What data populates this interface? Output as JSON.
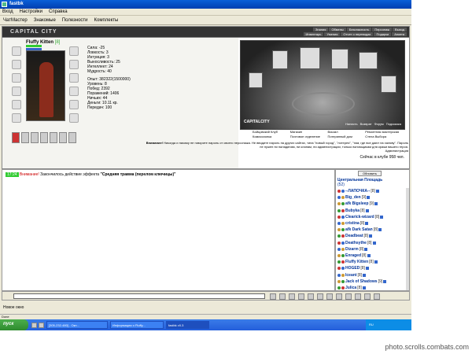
{
  "window": {
    "title": "fastbk"
  },
  "menubar": {
    "items": [
      "Вход",
      "Настройки",
      "Справка"
    ]
  },
  "toolbar": {
    "items": [
      "ЧатМастер",
      "Знакомые",
      "Полезности",
      "Комплекты"
    ]
  },
  "game": {
    "logo": "CAPITAL CITY",
    "nav_top": [
      "Знания",
      "Обмены",
      "Безопасность",
      "Персонаж",
      "Выход"
    ],
    "nav_bottom": [
      "Инвентарь",
      "Умения",
      "Отчет о переводах",
      "Подарки",
      "Анкета"
    ]
  },
  "character": {
    "name": "Fluffy Kitten",
    "level": "[8]",
    "stats": [
      "Сила: -25",
      "Ловкость: 3",
      "Интуиция: 3",
      "Выносливость: 25",
      "Интеллект: 24",
      "Мудрость: 40"
    ],
    "info": [
      "Опыт: 382322(1500000)",
      "Уровень: 8",
      "Побед: 2392",
      "Поражений: 1406",
      "Ничьих: 44",
      "Деньги: 10.11 кр.",
      "Передач: 100"
    ]
  },
  "city": {
    "logo": "CAPITALCITY",
    "menu": [
      "Напасть",
      "Возврат",
      "Форум",
      "Подсказка"
    ],
    "links": [
      "Бойцовский Клуб",
      "Магазин",
      "Вокзал",
      "Ремонтная мастерская",
      "Комиссионка",
      "Почтовое отделение",
      "Потерянный дом",
      "Стела Выбора"
    ]
  },
  "warning": {
    "prefix": "Внимание!",
    "text": "Никогда и никому не говорите пароль от своего персонажа. Не вводите пароль на других сайтах, типа \"новый город\", \"лотерея\", \"там, где все дают на халяву\". Пароль не нужен ни паладинам, ни кланам, ни администрации, только взломщикам для кражи вашего героя.",
    "signature": "Администрация",
    "online": "Сейчас в клубе 958 чел."
  },
  "chat": {
    "tag": "17:24",
    "attention": "Внимание!",
    "message": "Закончилось действие эффекта",
    "effect": "\"Средняя травма (перелом ключицы)\""
  },
  "roster": {
    "refresh": "Обновить",
    "title": "Центральная Площадь",
    "count": "(52)",
    "players": [
      {
        "name": "--ЛАПОЧКА--",
        "level": "[8]"
      },
      {
        "name": "Big_den",
        "level": "[9]"
      },
      {
        "name": "afk Bigsleep",
        "level": "[9]"
      },
      {
        "name": "Bubyka",
        "level": "[8]"
      },
      {
        "name": "Clearick-wizard",
        "level": "[8]"
      },
      {
        "name": "cristina",
        "level": "[8]"
      },
      {
        "name": "afk Dark Satan",
        "level": "[8]"
      },
      {
        "name": "Deadbeat",
        "level": "[8]"
      },
      {
        "name": "Deathsythe",
        "level": "[8]"
      },
      {
        "name": "Dizarm",
        "level": "[8]"
      },
      {
        "name": "Enraged",
        "level": "[8]"
      },
      {
        "name": "Fluffy Kitten",
        "level": "[8]"
      },
      {
        "name": "HOGED",
        "level": "[8]"
      },
      {
        "name": "Iceant",
        "level": "[8]"
      },
      {
        "name": "Jack of Shadows",
        "level": "[9]"
      },
      {
        "name": "Julica",
        "level": "[8]"
      },
      {
        "name": "afk Motion Mouse",
        "level": "[1"
      }
    ]
  },
  "bottom": {
    "new_window": "Новое окно",
    "status": "Done"
  },
  "taskbar": {
    "start": "пуск",
    "tasks": [
      "[305-232-480] - Окн...",
      "Информация о Fluffy...",
      "fastbk v0.3"
    ],
    "tray": "RU"
  },
  "watermark": "photo.scrolls.combats.com"
}
